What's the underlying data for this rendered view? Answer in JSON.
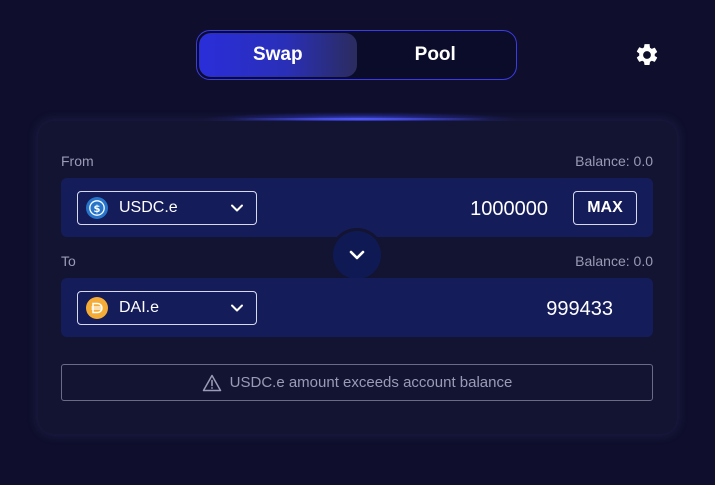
{
  "tabs": [
    {
      "label": "Swap",
      "active": true
    },
    {
      "label": "Pool",
      "active": false
    }
  ],
  "settings_icon": "gear-icon",
  "from": {
    "label": "From",
    "balance": "Balance: 0.0",
    "token": "USDC.e",
    "token_icon": "usdc-icon",
    "amount": "1000000",
    "max_label": "MAX"
  },
  "to": {
    "label": "To",
    "balance": "Balance: 0.0",
    "token": "DAI.e",
    "token_icon": "dai-icon",
    "amount": "999433"
  },
  "swap_direction_icon": "chevron-down-icon",
  "warning": {
    "icon": "warning-icon",
    "text": "USDC.e amount exceeds account balance"
  },
  "colors": {
    "background": "#0f0f2d",
    "card": "#131432",
    "row": "#151c5a",
    "accent": "#3b3be8",
    "muted_text": "#9a9bb5",
    "usdc": "#2775ca",
    "dai": "#f5ac37"
  }
}
